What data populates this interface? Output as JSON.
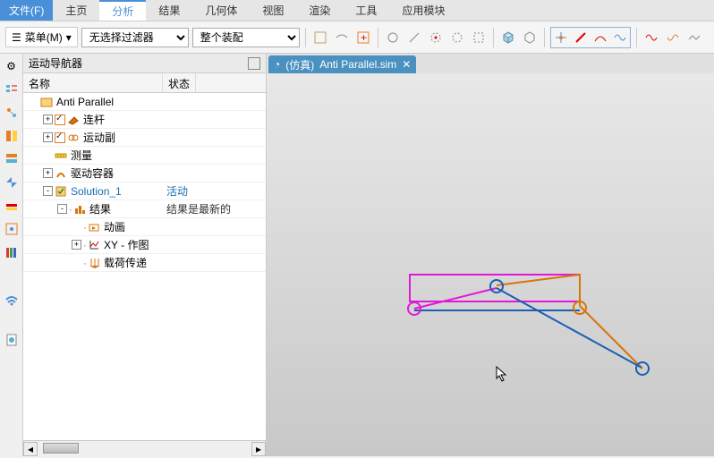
{
  "menubar": {
    "file": "文件(F)",
    "tabs": [
      "主页",
      "分析",
      "结果",
      "几何体",
      "视图",
      "渲染",
      "工具",
      "应用模块"
    ],
    "active_index": 1
  },
  "toolbar": {
    "menu_button": "菜单(M)",
    "filter_select": "无选择过滤器",
    "assembly_select": "整个装配"
  },
  "nav": {
    "title": "运动导航器",
    "col_name": "名称",
    "col_status": "状态",
    "tree": [
      {
        "depth": 0,
        "exp": "",
        "chk": null,
        "icon": "model",
        "label": "Anti Parallel",
        "status": "",
        "link": false
      },
      {
        "depth": 1,
        "exp": "+",
        "chk": true,
        "icon": "link",
        "label": "连杆",
        "status": "",
        "link": false
      },
      {
        "depth": 1,
        "exp": "+",
        "chk": true,
        "icon": "joint",
        "label": "运动副",
        "status": "",
        "link": false
      },
      {
        "depth": 1,
        "exp": "",
        "chk": null,
        "icon": "measure",
        "label": "测量",
        "status": "",
        "link": false
      },
      {
        "depth": 1,
        "exp": "+",
        "chk": null,
        "icon": "driver",
        "label": "驱动容器",
        "status": "",
        "link": false
      },
      {
        "depth": 1,
        "exp": "-",
        "chk": null,
        "icon": "solution",
        "label": "Solution_1",
        "status": "活动",
        "link": true
      },
      {
        "depth": 2,
        "exp": "-",
        "chk": null,
        "icon": "result",
        "label": "结果",
        "status": "结果是最新的",
        "link": false
      },
      {
        "depth": 3,
        "exp": "",
        "chk": null,
        "icon": "anim",
        "label": "动画",
        "status": "",
        "link": false
      },
      {
        "depth": 3,
        "exp": "+",
        "chk": null,
        "icon": "xy",
        "label": "XY - 作图",
        "status": "",
        "link": false
      },
      {
        "depth": 3,
        "exp": "",
        "chk": null,
        "icon": "load",
        "label": "载荷传递",
        "status": "",
        "link": false
      }
    ]
  },
  "viewport": {
    "tab_prefix": "(仿真)",
    "tab_label": "Anti Parallel.sim"
  },
  "colors": {
    "magenta": "#e018d8",
    "orange": "#d9730b",
    "blue": "#1a5fb4"
  }
}
